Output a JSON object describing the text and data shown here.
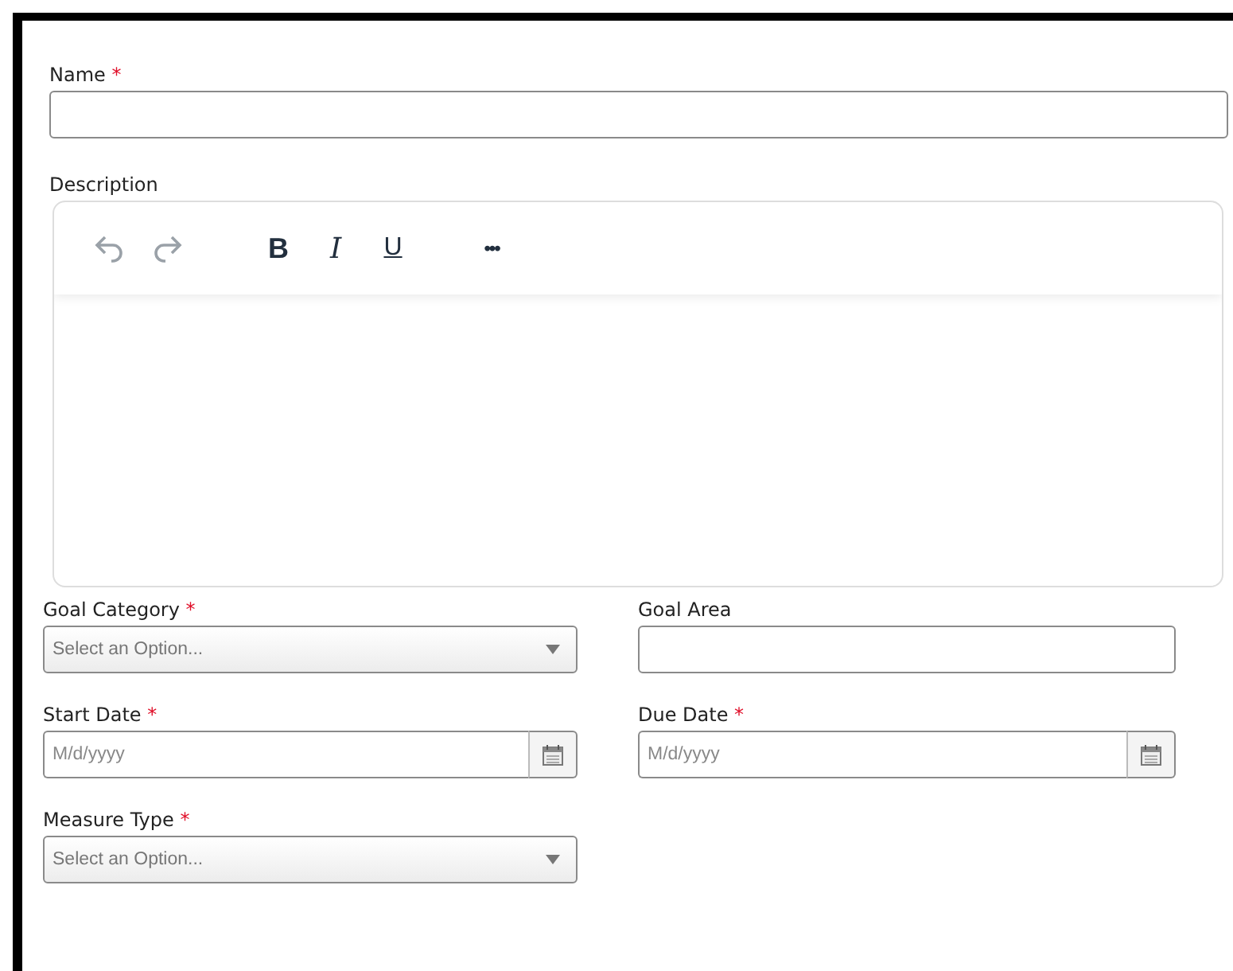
{
  "name_field": {
    "label": "Name",
    "required_mark": "*",
    "kind": "text"
  },
  "description": {
    "label": "Description",
    "toolbar": [
      {
        "kind": "undo",
        "disabled": true
      },
      {
        "kind": "redo",
        "disabled": true
      },
      {
        "kind": "bold",
        "label": "B",
        "disabled": false
      },
      {
        "kind": "italic",
        "label": "I",
        "disabled": false
      },
      {
        "kind": "underline",
        "label": "U",
        "disabled": false
      },
      {
        "kind": "more",
        "label": "•••",
        "disabled": false
      }
    ]
  },
  "fields": [
    {
      "label": "Goal Category",
      "required_mark": "*",
      "kind": "select",
      "placeholder": "Select an Option..."
    },
    {
      "label": "Goal Area",
      "kind": "text"
    },
    {
      "label": "Start Date",
      "required_mark": "*",
      "kind": "date",
      "placeholder": "M/d/yyyy"
    },
    {
      "label": "Due Date",
      "required_mark": "*",
      "kind": "date",
      "placeholder": "M/d/yyyy"
    },
    {
      "label": "Measure Type",
      "required_mark": "*",
      "kind": "select",
      "placeholder": "Select an Option..."
    }
  ]
}
